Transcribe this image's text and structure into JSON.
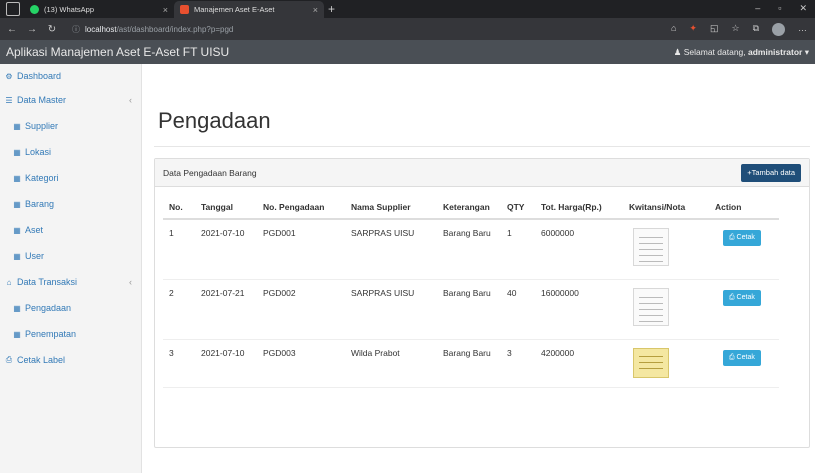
{
  "browser": {
    "tabs": [
      {
        "title": "(13) WhatsApp",
        "favicon_color": "#25d366",
        "active": false
      },
      {
        "title": "Manajemen Aset E-Aset",
        "favicon_color": "#e8502f",
        "active": true
      }
    ],
    "new_tab": "+",
    "url_host": "localhost",
    "url_path": "/ast/dashboard/index.php?p=pgd"
  },
  "app": {
    "title": "Aplikasi Manajemen Aset E-Aset FT UISU",
    "welcome": "Selamat datang,",
    "user": "administrator"
  },
  "sidebar": {
    "items": [
      {
        "label": "Dashboard",
        "icon": "dashboard-icon",
        "glyph": "⚙",
        "level": "top",
        "chevron": ""
      },
      {
        "label": "Data Master",
        "icon": "list-icon",
        "glyph": "☰",
        "level": "top",
        "chevron": "‹"
      },
      {
        "label": "Supplier",
        "icon": "table-icon",
        "glyph": "▦",
        "level": "sub",
        "chevron": ""
      },
      {
        "label": "Lokasi",
        "icon": "table-icon",
        "glyph": "▦",
        "level": "sub",
        "chevron": ""
      },
      {
        "label": "Kategori",
        "icon": "table-icon",
        "glyph": "▦",
        "level": "sub",
        "chevron": ""
      },
      {
        "label": "Barang",
        "icon": "table-icon",
        "glyph": "▦",
        "level": "sub",
        "chevron": ""
      },
      {
        "label": "Aset",
        "icon": "table-icon",
        "glyph": "▦",
        "level": "sub",
        "chevron": ""
      },
      {
        "label": "User",
        "icon": "table-icon",
        "glyph": "▦",
        "level": "sub",
        "chevron": ""
      },
      {
        "label": "Data Transaksi",
        "icon": "bank-icon",
        "glyph": "⌂",
        "level": "top",
        "chevron": "‹"
      },
      {
        "label": "Pengadaan",
        "icon": "table-icon",
        "glyph": "▦",
        "level": "sub",
        "chevron": ""
      },
      {
        "label": "Penempatan",
        "icon": "table-icon",
        "glyph": "▦",
        "level": "sub",
        "chevron": ""
      },
      {
        "label": "Cetak Label",
        "icon": "print-icon",
        "glyph": "⎙",
        "level": "top",
        "chevron": ""
      }
    ]
  },
  "main": {
    "page_title": "Pengadaan",
    "panel_title": "Data Pengadaan Barang",
    "add_button": "+Tambah data",
    "columns": [
      "No.",
      "Tanggal",
      "No. Pengadaan",
      "Nama Supplier",
      "Keterangan",
      "QTY",
      "Tot. Harga(Rp.)",
      "Kwitansi/Nota",
      "Action"
    ],
    "rows": [
      {
        "no": "1",
        "tanggal": "2021-07-10",
        "no_pengadaan": "PGD001",
        "supplier": "SARPRAS UISU",
        "keterangan": "Barang Baru",
        "qty": "1",
        "total": "6000000",
        "thumb": "receipt-white",
        "action": "Cetak"
      },
      {
        "no": "2",
        "tanggal": "2021-07-21",
        "no_pengadaan": "PGD002",
        "supplier": "SARPRAS UISU",
        "keterangan": "Barang Baru",
        "qty": "40",
        "total": "16000000",
        "thumb": "receipt-white",
        "action": "Cetak"
      },
      {
        "no": "3",
        "tanggal": "2021-07-10",
        "no_pengadaan": "PGD003",
        "supplier": "Wilda Prabot",
        "keterangan": "Barang Baru",
        "qty": "3",
        "total": "4200000",
        "thumb": "receipt-yellow",
        "action": "Cetak"
      }
    ]
  },
  "colors": {
    "header": "#4a4f55",
    "link": "#337ab7",
    "add_button": "#1f4e79",
    "print_button": "#35a7d8"
  }
}
